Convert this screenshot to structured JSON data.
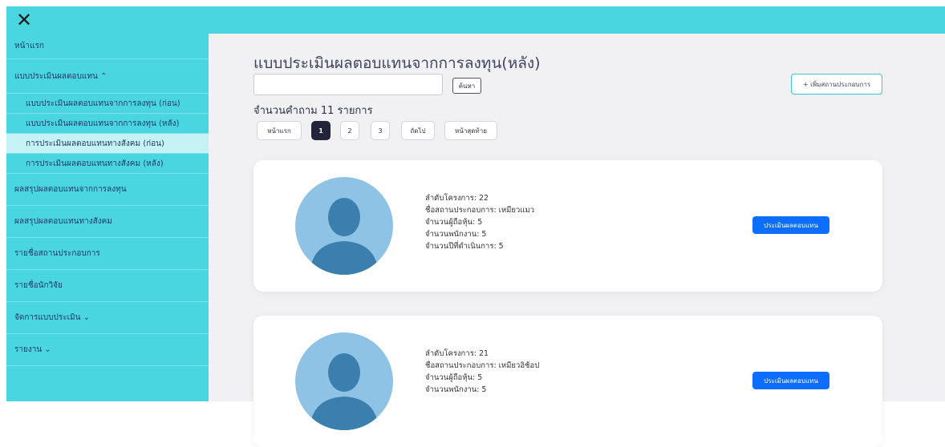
{
  "topbar": {
    "close_icon": "close-icon"
  },
  "sidebar": {
    "items": [
      {
        "label": "หน้าแรก"
      },
      {
        "label": "แบบประเมินผลตอบแทน ⌃"
      },
      {
        "label": "แบบประเมินผลตอบแทนจากการลงทุน (ก่อน)"
      },
      {
        "label": "แบบประเมินผลตอบแทนจากการลงทุน (หลัง)"
      },
      {
        "label": "การประเมินผลตอบแทนทางสังคม (ก่อน)"
      },
      {
        "label": "การประเมินผลตอบแทนทางสังคม (หลัง)"
      },
      {
        "label": "ผลสรุปผลตอบแทนจากการลงทุน"
      },
      {
        "label": "ผลสรุปผลตอบแทนทางสังคม"
      },
      {
        "label": "รายชื่อสถานประกอบการ"
      },
      {
        "label": "รายชื่อนักวิจัย"
      },
      {
        "label": "จัดการแบบประเมิน ⌄"
      },
      {
        "label": "รายงาน ⌄"
      }
    ]
  },
  "main": {
    "title": "แบบประเมินผลตอบแทนจากการลงทุน(หลัง)",
    "search": {
      "value": "",
      "placeholder": "",
      "button_label": "ค้นหา"
    },
    "add_button_label": "+ เพิ่มสถานประกอบการ",
    "count_text": "จำนวนคำถาม 11 รายการ",
    "pagination": {
      "first": "หน้าแรก",
      "pages": [
        "1",
        "2",
        "3"
      ],
      "active_page": "1",
      "next": "ถัดไป",
      "last": "หน้าสุดท้าย"
    },
    "cards": [
      {
        "project_no": "ลำดับโครงการ: 22",
        "company": "ชื่อสถานประกอบการ: เหมียวแมว",
        "shareholders": "จำนวนผู้ถือหุ้น: 5",
        "employees": "จำนวนพนักงาน: 5",
        "years": "จำนวนปีที่ดำเนินการ: 5",
        "button_label": "ประเมินผลตอบแทน"
      },
      {
        "project_no": "ลำดับโครงการ: 21",
        "company": "ชื่อสถานประกอบการ: เหมียวอิช้อป",
        "shareholders": "จำนวนผู้ถือหุ้น: 5",
        "employees": "จำนวนพนักงาน: 5",
        "years": "",
        "button_label": "ประเมินผลตอบแทน"
      }
    ]
  },
  "colors": {
    "cyan": "#49d6e1",
    "active_sub": "#c6f2f5",
    "main_bg": "#f1f1f3",
    "primary": "#0d6efd",
    "page_active": "#22253a",
    "avatar_bg": "#8fc3e5",
    "avatar_fg": "#3a7fae"
  }
}
